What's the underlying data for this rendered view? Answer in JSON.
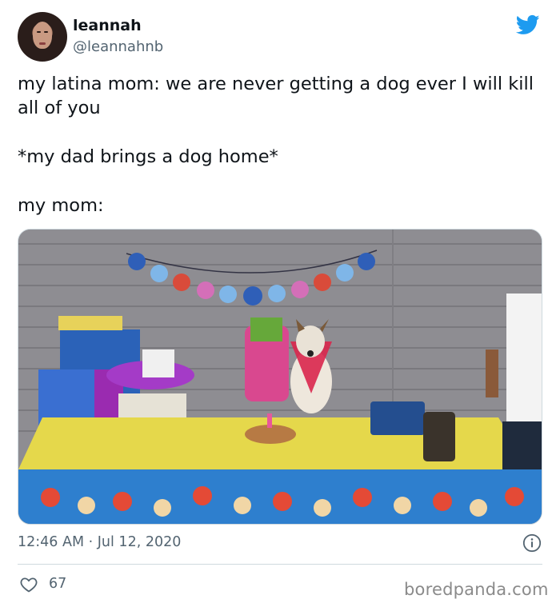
{
  "user": {
    "display_name": "leannah",
    "handle": "@leannahnb"
  },
  "tweet": {
    "lines": [
      "my latina mom: we are never getting a dog ever I will kill all of you",
      "*my dad brings a dog home*",
      "my mom:"
    ],
    "timestamp": "12:46 AM · Jul 12, 2020",
    "likes": "67"
  },
  "icons": {
    "platform": "twitter-bird-icon",
    "info": "info-icon",
    "like": "heart-icon"
  },
  "colors": {
    "brand": "#1d9bf0",
    "text": "#0f1419",
    "secondary": "#536471"
  },
  "watermark": "boredpanda.com"
}
